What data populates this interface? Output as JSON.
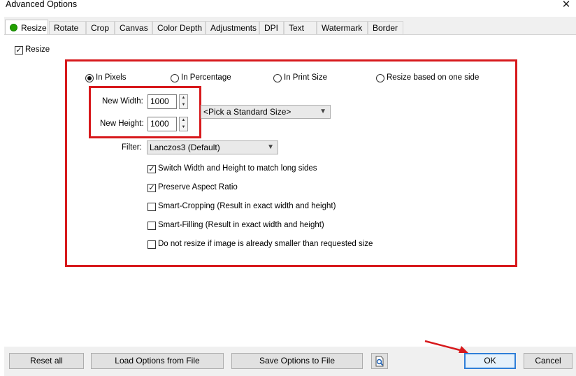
{
  "window": {
    "title": "Advanced Options",
    "close_glyph": "✕"
  },
  "tabs": [
    {
      "label": "Resize",
      "active": true
    },
    {
      "label": "Rotate"
    },
    {
      "label": "Crop"
    },
    {
      "label": "Canvas"
    },
    {
      "label": "Color Depth"
    },
    {
      "label": "Adjustments"
    },
    {
      "label": "DPI"
    },
    {
      "label": "Text"
    },
    {
      "label": "Watermark"
    },
    {
      "label": "Border"
    }
  ],
  "resize": {
    "enable_label": "Resize",
    "enabled": true,
    "modes": [
      {
        "label": "In Pixels",
        "selected": true
      },
      {
        "label": "In Percentage",
        "selected": false
      },
      {
        "label": "In Print Size",
        "selected": false
      },
      {
        "label": "Resize based on one side",
        "selected": false
      }
    ],
    "width_label": "New Width:",
    "width_value": "1000",
    "height_label": "New Height:",
    "height_value": "1000",
    "standard_size": "<Pick a Standard Size>",
    "filter_label": "Filter:",
    "filter_value": "Lanczos3 (Default)",
    "options": [
      {
        "label": "Switch Width and Height to match long sides",
        "checked": true
      },
      {
        "label": "Preserve Aspect Ratio",
        "checked": true
      },
      {
        "label": "Smart-Cropping (Result in exact width and height)",
        "checked": false
      },
      {
        "label": "Smart-Filling (Result in exact width and height)",
        "checked": false
      },
      {
        "label": "Do not resize if image is already smaller than requested size",
        "checked": false
      }
    ]
  },
  "footer": {
    "reset_all": "Reset all",
    "load_options": "Load Options from File",
    "save_options": "Save Options to File",
    "preview_icon": "magnifier-page-icon",
    "ok": "OK",
    "cancel": "Cancel"
  },
  "colors": {
    "highlight_red": "#d7191c",
    "ok_border": "#2f7fd8",
    "active_tab_dot": "#22a000"
  }
}
